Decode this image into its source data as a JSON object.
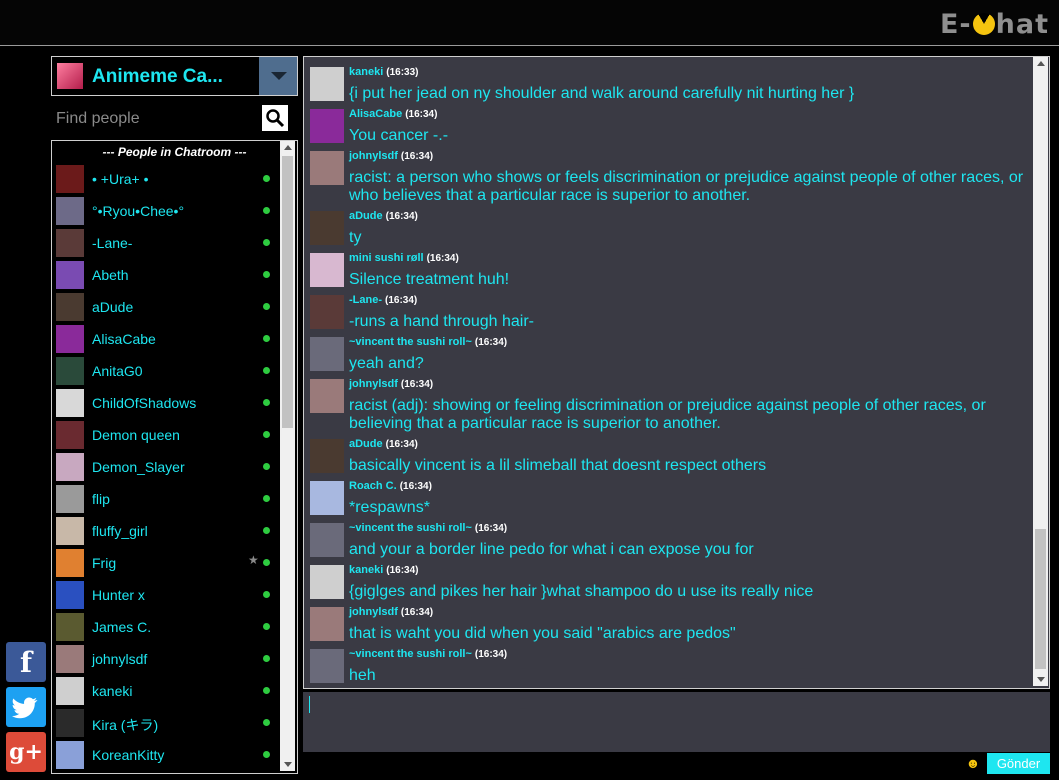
{
  "app": {
    "logo_prefix": "E-",
    "logo_suffix": "hat"
  },
  "room": {
    "name": "Animeme Ca..."
  },
  "search": {
    "placeholder": "Find people"
  },
  "people_header": "--- People in Chatroom ---",
  "people": [
    {
      "name": "• +Ura+ •",
      "color": "#6b1a1a"
    },
    {
      "name": "°•Ryou•Chee•°",
      "color": "#6d6a88"
    },
    {
      "name": "-Lane-",
      "color": "#5a3a38"
    },
    {
      "name": "Abeth",
      "color": "#7a4bb2"
    },
    {
      "name": "aDude",
      "color": "#4a3a30"
    },
    {
      "name": "AlisaCabe",
      "color": "#8a2a9a"
    },
    {
      "name": "AnitaG0",
      "color": "#2a4a3a"
    },
    {
      "name": "ChildOfShadows",
      "color": "#d8d8d8"
    },
    {
      "name": "Demon queen",
      "color": "#6a2a30"
    },
    {
      "name": "Demon_Slayer",
      "color": "#c8a8c0"
    },
    {
      "name": "flip",
      "color": "#9a9a9a"
    },
    {
      "name": "fluffy_girl",
      "color": "#c8b8a8"
    },
    {
      "name": "Frig",
      "color": "#e08030",
      "star": "★"
    },
    {
      "name": "Hunter x",
      "color": "#2a50c0"
    },
    {
      "name": "James C.",
      "color": "#5a5a30"
    },
    {
      "name": "johnylsdf",
      "color": "#9a7a7a"
    },
    {
      "name": "kaneki",
      "color": "#cfcfcf"
    },
    {
      "name": "Kira (キラ)",
      "color": "#2a2a2a"
    },
    {
      "name": "KoreanKitty",
      "color": "#8aa0d8"
    }
  ],
  "messages": [
    {
      "user": "kaneki",
      "time": "(16:33)",
      "text": "{i put her jead on ny shoulder and walk around carefully nit hurting her }",
      "color": "#cfcfcf"
    },
    {
      "user": "AlisaCabe",
      "time": "(16:34)",
      "text": "You cancer -.-",
      "color": "#8a2a9a"
    },
    {
      "user": "johnylsdf",
      "time": "(16:34)",
      "text": "racist: a person who shows or feels discrimination or prejudice against people of other races, or who believes that a particular race is superior to another.",
      "color": "#9a7a7a"
    },
    {
      "user": "aDude",
      "time": "(16:34)",
      "text": "ty",
      "color": "#4a3a30"
    },
    {
      "user": "mini sushi røll",
      "time": "(16:34)",
      "text": "Silence treatment huh!",
      "color": "#d8b8d0"
    },
    {
      "user": "-Lane-",
      "time": "(16:34)",
      "text": "-runs a hand through hair-",
      "color": "#5a3a38"
    },
    {
      "user": "~vincent the sushi roll~",
      "time": "(16:34)",
      "text": "yeah and?",
      "color": "#6a6a7a"
    },
    {
      "user": "johnylsdf",
      "time": "(16:34)",
      "text": "racist (adj): showing or feeling discrimination or prejudice against people of other races, or believing that a particular race is superior to another.",
      "color": "#9a7a7a"
    },
    {
      "user": "aDude",
      "time": "(16:34)",
      "text": "basically vincent is a lil slimeball that doesnt respect others",
      "color": "#4a3a30"
    },
    {
      "user": "Roach C.",
      "time": "(16:34)",
      "text": "*respawns*",
      "color": "#a8b8e0"
    },
    {
      "user": "~vincent the sushi roll~",
      "time": "(16:34)",
      "text": "and your a border line pedo for what i can expose you for",
      "color": "#6a6a7a"
    },
    {
      "user": "kaneki",
      "time": "(16:34)",
      "text": "{giglges and pikes her hair }what shampoo do u use its really nice",
      "color": "#cfcfcf"
    },
    {
      "user": "johnylsdf",
      "time": "(16:34)",
      "text": "that is waht you did when you said \"arabics are pedos\"",
      "color": "#9a7a7a"
    },
    {
      "user": "~vincent the sushi roll~",
      "time": "(16:34)",
      "text": "heh",
      "color": "#6a6a7a"
    }
  ],
  "social": {
    "facebook": "f",
    "googleplus": "g+"
  },
  "composer": {
    "send_label": "Gönder",
    "emoji_icon": "☻"
  }
}
